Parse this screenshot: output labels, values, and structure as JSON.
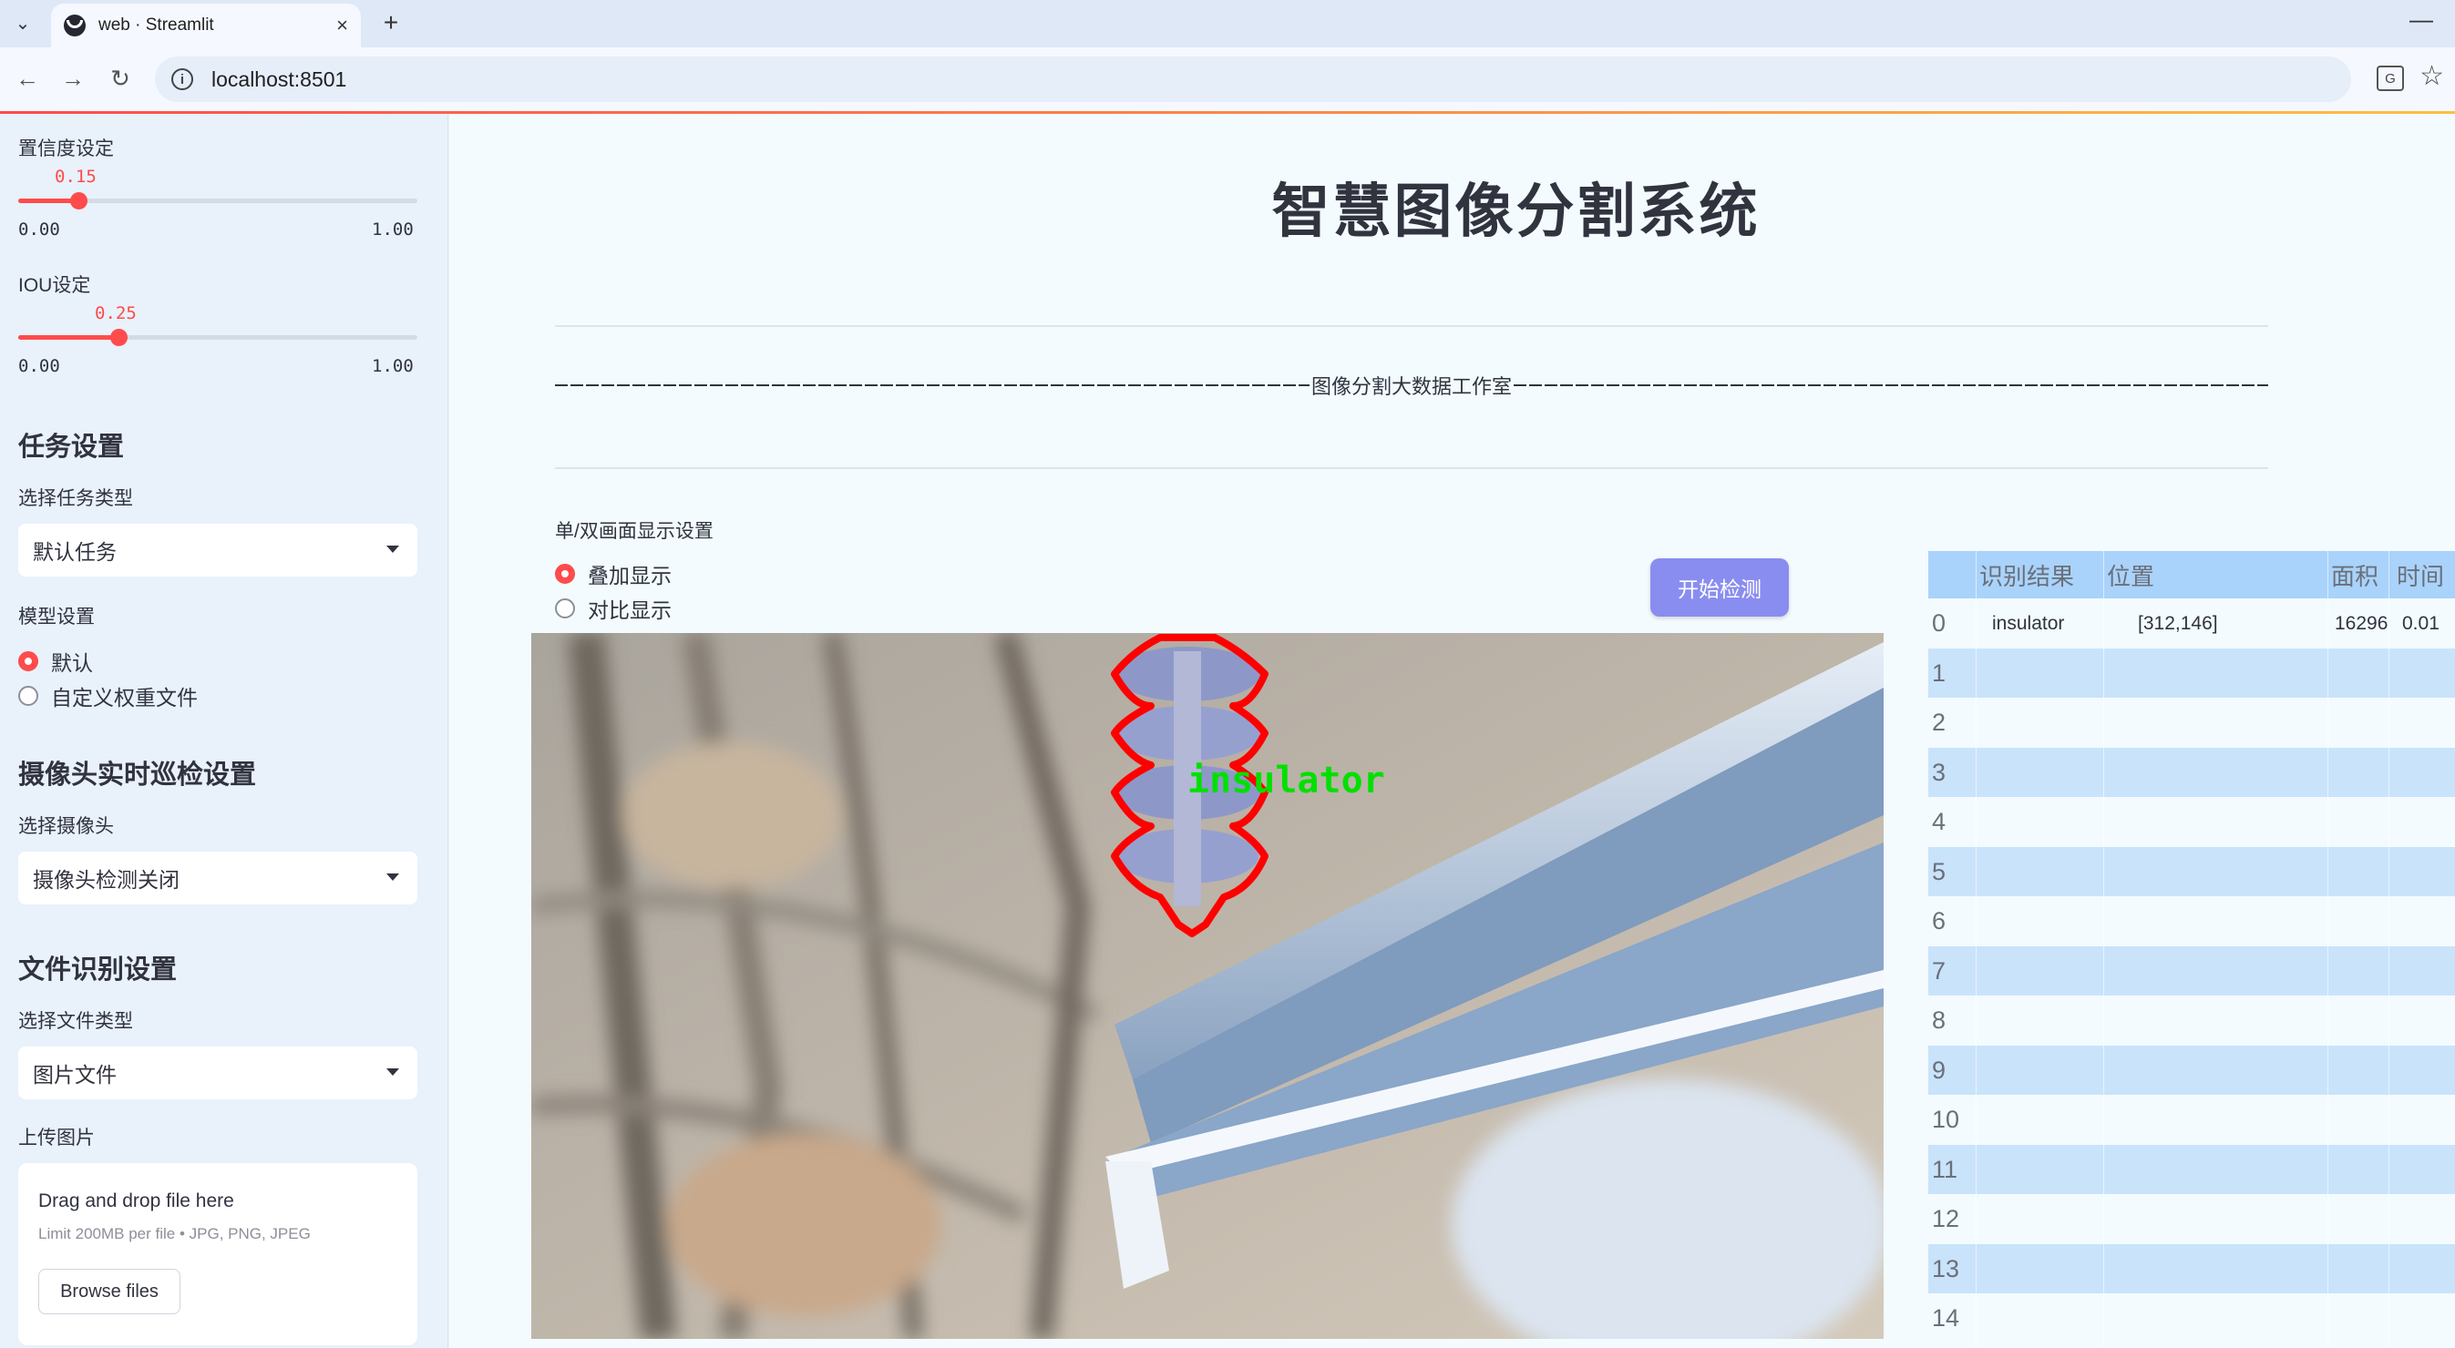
{
  "browser": {
    "tab_title": "web · Streamlit",
    "url": "localhost:8501",
    "new_tab_symbol": "+",
    "close_symbol": "×",
    "minimize_symbol": "—"
  },
  "sidebar": {
    "confidence": {
      "label": "置信度设定",
      "value_text": "0.15",
      "value": 0.15,
      "min": "0.00",
      "max": "1.00"
    },
    "iou": {
      "label": "IOU设定",
      "value_text": "0.25",
      "value": 0.25,
      "min": "0.00",
      "max": "1.00"
    },
    "task_section": {
      "title": "任务设置",
      "select_label": "选择任务类型",
      "selected": "默认任务"
    },
    "model_section": {
      "label": "模型设置",
      "options": [
        "默认",
        "自定义权重文件"
      ],
      "selected_index": 0
    },
    "camera_section": {
      "title": "摄像头实时巡检设置",
      "select_label": "选择摄像头",
      "selected": "摄像头检测关闭"
    },
    "file_section": {
      "title": "文件识别设置",
      "select_label": "选择文件类型",
      "selected": "图片文件"
    },
    "upload": {
      "label": "上传图片",
      "drop_text": "Drag and drop file here",
      "limit_text": "Limit 200MB per file • JPG, PNG, JPEG",
      "browse_label": "Browse files"
    }
  },
  "main": {
    "title": "智慧图像分割系统",
    "subtitle": "图像分割大数据工作室",
    "display_mode": {
      "label": "单/双画面显示设置",
      "options": [
        "叠加显示",
        "对比显示"
      ],
      "selected_index": 0
    },
    "start_button": "开始检测",
    "detection_label": "insulator"
  },
  "table": {
    "columns": [
      "",
      "识别结果",
      "位置",
      "面积",
      "时间"
    ],
    "rows": [
      {
        "index": "0",
        "result": "insulator",
        "position": "[312,146]",
        "area": "16296",
        "time": "0.01"
      },
      {
        "index": "1",
        "result": "",
        "position": "",
        "area": "",
        "time": ""
      },
      {
        "index": "2",
        "result": "",
        "position": "",
        "area": "",
        "time": ""
      },
      {
        "index": "3",
        "result": "",
        "position": "",
        "area": "",
        "time": ""
      },
      {
        "index": "4",
        "result": "",
        "position": "",
        "area": "",
        "time": ""
      },
      {
        "index": "5",
        "result": "",
        "position": "",
        "area": "",
        "time": ""
      },
      {
        "index": "6",
        "result": "",
        "position": "",
        "area": "",
        "time": ""
      },
      {
        "index": "7",
        "result": "",
        "position": "",
        "area": "",
        "time": ""
      },
      {
        "index": "8",
        "result": "",
        "position": "",
        "area": "",
        "time": ""
      },
      {
        "index": "9",
        "result": "",
        "position": "",
        "area": "",
        "time": ""
      },
      {
        "index": "10",
        "result": "",
        "position": "",
        "area": "",
        "time": ""
      },
      {
        "index": "11",
        "result": "",
        "position": "",
        "area": "",
        "time": ""
      },
      {
        "index": "12",
        "result": "",
        "position": "",
        "area": "",
        "time": ""
      },
      {
        "index": "13",
        "result": "",
        "position": "",
        "area": "",
        "time": ""
      },
      {
        "index": "14",
        "result": "",
        "position": "",
        "area": "",
        "time": ""
      }
    ]
  },
  "colors": {
    "accent": "#ff4b4b",
    "button": "#8a8df0",
    "table_header": "#a9d3fb",
    "table_stripe": "#c9e3fb",
    "mask_outline": "#ff0000",
    "label_text": "#00e000"
  }
}
